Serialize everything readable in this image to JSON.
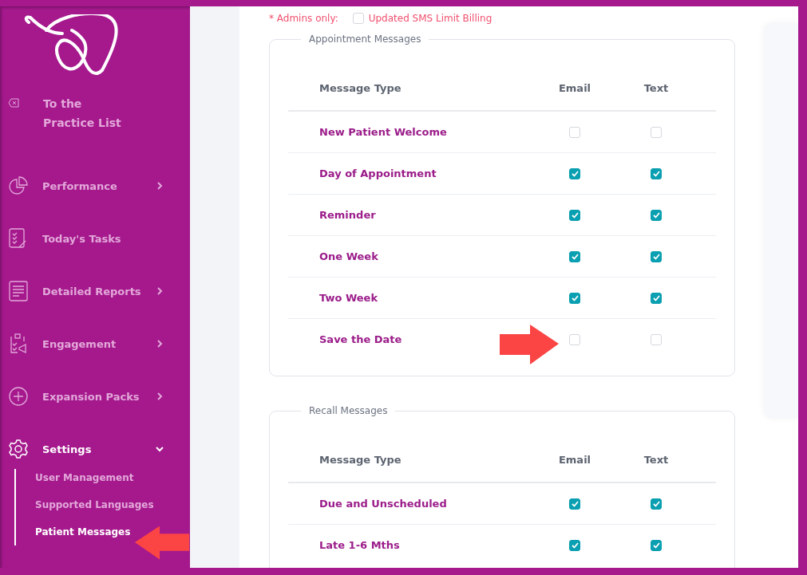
{
  "sidebar": {
    "back_link": {
      "label_lines": [
        "To the",
        "Practice List"
      ]
    },
    "items": [
      {
        "label": "Performance",
        "kind": "group",
        "expanded": false
      },
      {
        "label": "Today's Tasks",
        "kind": "link"
      },
      {
        "label": "Detailed Reports",
        "kind": "group",
        "expanded": false
      },
      {
        "label": "Engagement",
        "kind": "group",
        "expanded": false
      },
      {
        "label": "Expansion Packs",
        "kind": "group",
        "expanded": false
      },
      {
        "label": "Settings",
        "kind": "group",
        "expanded": true,
        "children": [
          {
            "label": "User Management",
            "selected": false
          },
          {
            "label": "Supported Languages",
            "selected": false
          },
          {
            "label": "Patient Messages",
            "selected": true
          }
        ]
      }
    ]
  },
  "admin_option": {
    "prefix": "* Admins only:",
    "label": "Updated SMS Limit Billing",
    "checked": false
  },
  "sections": [
    {
      "title": "Appointment Messages",
      "columns": [
        "Message Type",
        "Email",
        "Text"
      ],
      "rows": [
        {
          "label": "New Patient Welcome",
          "email": false,
          "text": false
        },
        {
          "label": "Day of Appointment",
          "email": true,
          "text": true
        },
        {
          "label": "Reminder",
          "email": true,
          "text": true
        },
        {
          "label": "One Week",
          "email": true,
          "text": true
        },
        {
          "label": "Two Week",
          "email": true,
          "text": true
        },
        {
          "label": "Save the Date",
          "email": false,
          "text": false
        }
      ]
    },
    {
      "title": "Recall Messages",
      "columns": [
        "Message Type",
        "Email",
        "Text"
      ],
      "rows": [
        {
          "label": "Due and Unscheduled",
          "email": true,
          "text": true
        },
        {
          "label": "Late 1-6 Mths",
          "email": true,
          "text": true
        }
      ]
    }
  ]
}
